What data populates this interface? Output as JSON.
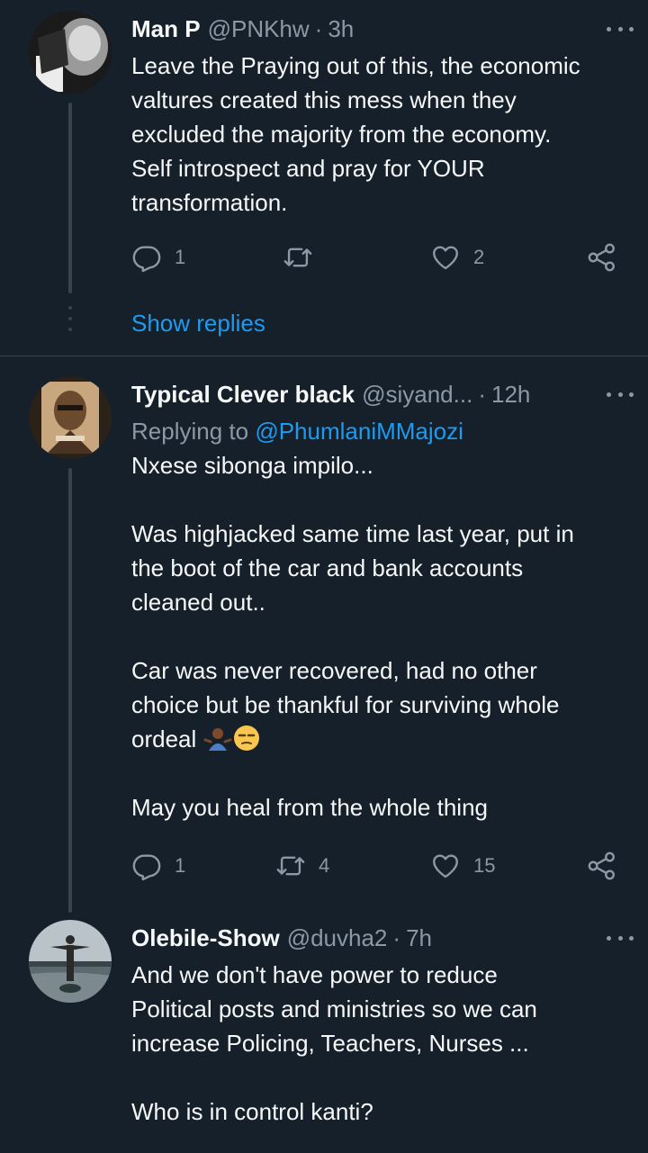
{
  "tweets": [
    {
      "name": "Man P",
      "handle": "@PNKhw",
      "time": "3h",
      "text": "Leave the Praying out of this, the economic\nvaltures created this mess when they\nexcluded the majority from the economy.\nSelf introspect and pray for YOUR\ntransformation.",
      "replies": "1",
      "retweets": "",
      "likes": "2",
      "show_replies": "Show replies"
    },
    {
      "name": "Typical Clever black",
      "handle": "@siyand...",
      "time": "12h",
      "replying_prefix": "Replying to",
      "replying_to": "@PhumlaniMMajozi",
      "text_part1": "Nxese sibonga impilo...\n\nWas highjacked same time last year, put in\nthe boot of the car and bank accounts\ncleaned out..\n\nCar was never recovered, had no other\nchoice but be thankful for surviving whole\nordeal",
      "text_part2": "May you heal from the whole thing",
      "emoji_1": "person-shrugging-emoji",
      "emoji_2": "unamused-face-emoji",
      "replies": "1",
      "retweets": "4",
      "likes": "15"
    },
    {
      "name": "Olebile-Show",
      "handle": "@duvha2",
      "time": "7h",
      "text": "And we don't have power to reduce\nPolitical posts and ministries so we can\nincrease Policing, Teachers, Nurses ...\n\nWho is in control kanti?"
    }
  ],
  "separator": "·",
  "colors": {
    "background": "#15202b",
    "text": "#f7f9f9",
    "secondary": "#8b98a5",
    "accent": "#1d9bf0",
    "line": "#38444d"
  }
}
